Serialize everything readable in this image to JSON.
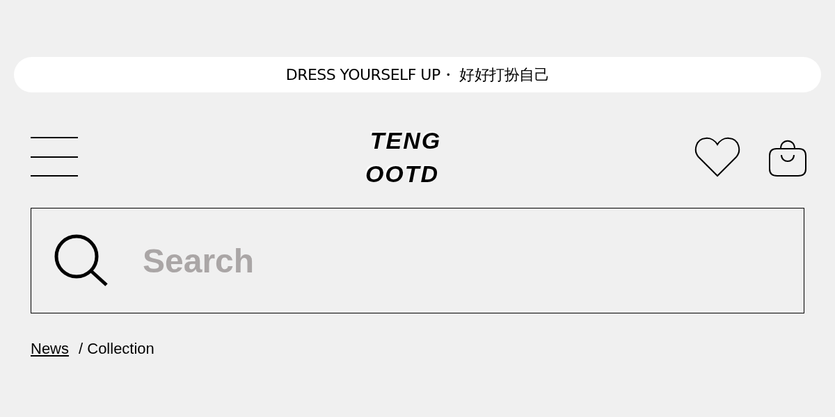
{
  "announcement": "DRESS YOURSELF UP・ 好好打扮自己",
  "logo": {
    "line_1": "TENG",
    "line_2": "OOTD"
  },
  "search": {
    "placeholder": "Search"
  },
  "breadcrumb": [
    {
      "label": "News",
      "kind": "link"
    },
    {
      "label": "/ Collection",
      "kind": "current"
    }
  ]
}
